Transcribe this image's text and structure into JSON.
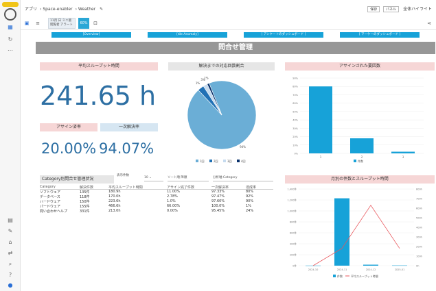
{
  "header": {
    "crumb1": "アプリ",
    "crumb2": "Space-enabler",
    "crumb3": "Weather",
    "field_a": "保存",
    "field_b": "パネル",
    "field_c": "全体ハイライト"
  },
  "toolbar": {
    "date_text": "11月 日 ミニ版 閲覧者 アラート",
    "zoom": "60%"
  },
  "page_buttons": [
    "[Overview]",
    "[tile Anomaly]",
    "[ アンケートのダッシュボード ]",
    "[ マーケーのダッシュボード ]"
  ],
  "page_title": "問合せ管理",
  "kpi1": {
    "label": "平均スループット時間",
    "value": "241.65 h"
  },
  "kpi2": {
    "label": "アサイン済率",
    "value": "20.00%"
  },
  "kpi3": {
    "label": "一次解決率",
    "value": "94.07%"
  },
  "pie": {
    "title": "解決までの対応回数割合",
    "labels": [
      "1%",
      "3%",
      "2%",
      "94%"
    ],
    "legend": [
      "1回",
      "2回",
      "3回",
      "4回"
    ]
  },
  "bar_chart": {
    "title": "アサインされた要因数",
    "legend": "件数"
  },
  "table_section": {
    "title": "Category別問合せ管理状況",
    "ctrl1_label": "表示件数",
    "ctrl1_value": "10",
    "ctrl2": "ソート順 降順",
    "ctrl3": "分析軸 Category",
    "headers": [
      "Category",
      "解決件数",
      "平均スループット時間",
      "アサイン完了件数",
      "一次解決率",
      "達成率"
    ],
    "rows": [
      [
        "ソフトウェア",
        "135件",
        "180.9h",
        "11.00%",
        "97.33%",
        "80%"
      ],
      [
        "データベース",
        "118件",
        "170.0h",
        "2.78%",
        "97.47%",
        "92%"
      ],
      [
        "ハードウェア",
        "150件",
        "223.6h",
        "1.0%",
        "97.60%",
        "90%"
      ],
      [
        "パードウェア",
        "155件",
        "466.6h",
        "66.00%",
        "100.0%",
        "1%"
      ],
      [
        "問い合わせヘルプ",
        "331件",
        "213.0h",
        "0.00%",
        "95.45%",
        "24%"
      ]
    ]
  },
  "combo": {
    "title": "月別の件数とスループット時間",
    "legend1": "件数",
    "legend2": "平均スループット時間"
  },
  "colors": {
    "accent": "#17a2d8",
    "kpi": "#2d6fa3",
    "pink": "#f6d6d6"
  },
  "chart_data": [
    {
      "type": "pie",
      "title": "解決までの対応回数割合",
      "categories": [
        "1回",
        "2回",
        "3回",
        "4回"
      ],
      "values": [
        94,
        3,
        2,
        1
      ]
    },
    {
      "type": "bar",
      "title": "アサインされた要因数",
      "categories": [
        "1",
        "2",
        "3"
      ],
      "values": [
        80,
        18,
        2
      ],
      "ylim": [
        0,
        90
      ],
      "yticks": [
        "0%",
        "10%",
        "20%",
        "30%",
        "40%",
        "50%",
        "60%",
        "70%",
        "80%",
        "90%"
      ]
    },
    {
      "type": "bar",
      "title": "月別の件数とスループット時間",
      "categories": [
        "2024-10",
        "2024-11",
        "2024-12",
        "2025-01"
      ],
      "series": [
        {
          "name": "件数",
          "values": [
            2,
            1230,
            18,
            5
          ]
        },
        {
          "name": "平均スループット時間",
          "values": [
            0,
            180,
            630,
            180
          ]
        }
      ],
      "ylim": [
        0,
        1400
      ],
      "y2lim": [
        0,
        800
      ]
    }
  ]
}
